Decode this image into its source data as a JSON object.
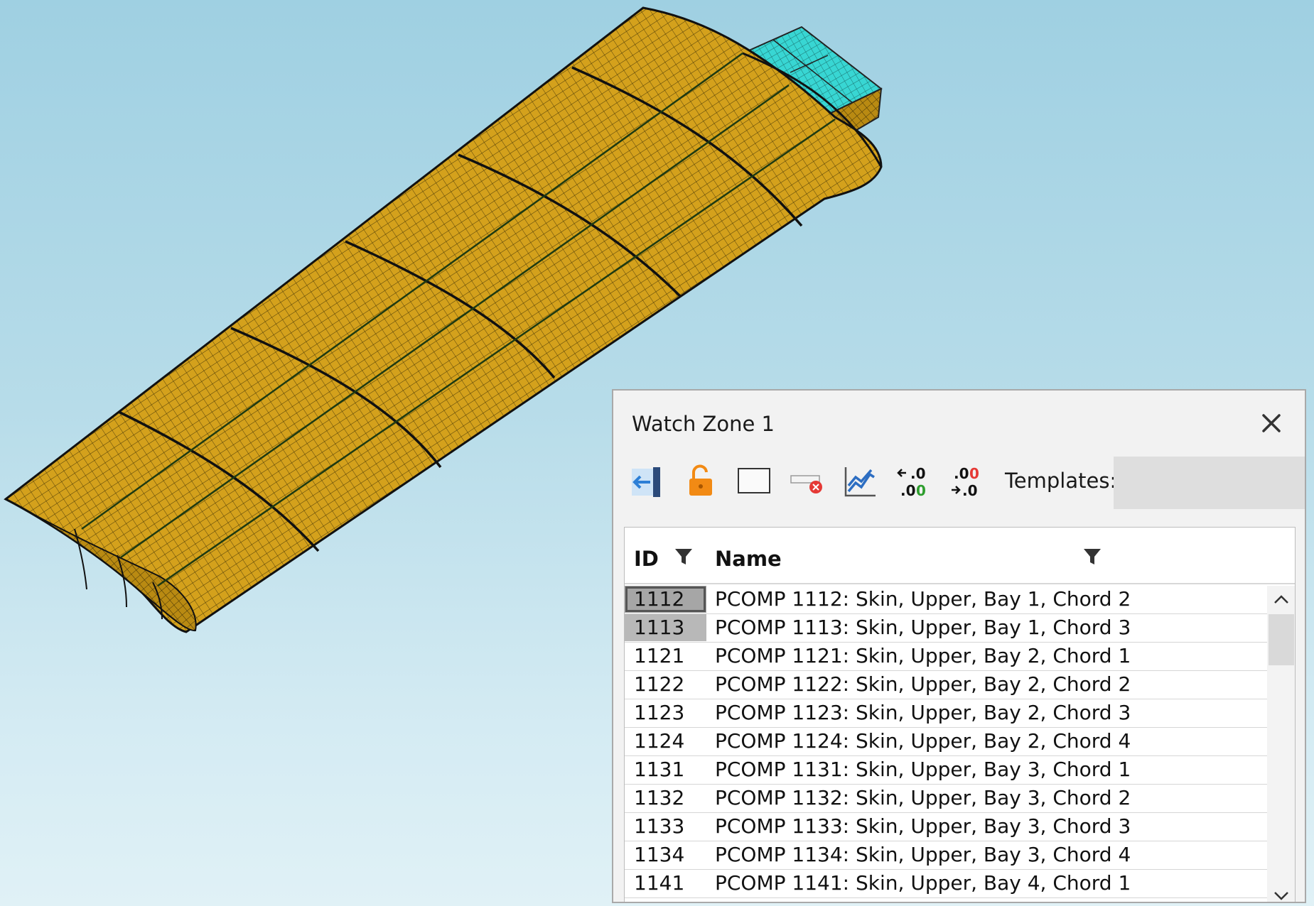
{
  "panel": {
    "title": "Watch Zone 1",
    "close_icon": "close-icon",
    "toolbar": {
      "tools": [
        {
          "name": "import-left-icon"
        },
        {
          "name": "unlock-icon"
        },
        {
          "name": "select-box-icon"
        },
        {
          "name": "clear-selection-icon"
        },
        {
          "name": "trend-chart-icon"
        },
        {
          "name": "increase-decimals-icon"
        },
        {
          "name": "decrease-decimals-icon"
        }
      ],
      "templates_label": "Templates:",
      "templates_value": ""
    },
    "table": {
      "columns": [
        "ID",
        "Name"
      ],
      "rows": [
        {
          "id": "1112",
          "name": "PCOMP 1112: Skin, Upper, Bay 1, Chord 2"
        },
        {
          "id": "1113",
          "name": "PCOMP 1113: Skin, Upper, Bay 1, Chord 3"
        },
        {
          "id": "1121",
          "name": "PCOMP 1121: Skin, Upper, Bay 2, Chord 1"
        },
        {
          "id": "1122",
          "name": "PCOMP 1122: Skin, Upper, Bay 2, Chord 2"
        },
        {
          "id": "1123",
          "name": "PCOMP 1123: Skin, Upper, Bay 2, Chord 3"
        },
        {
          "id": "1124",
          "name": "PCOMP 1124: Skin, Upper, Bay 2, Chord 4"
        },
        {
          "id": "1131",
          "name": "PCOMP 1131: Skin, Upper, Bay 3, Chord 1"
        },
        {
          "id": "1132",
          "name": "PCOMP 1132: Skin, Upper, Bay 3, Chord 2"
        },
        {
          "id": "1133",
          "name": "PCOMP 1133: Skin, Upper, Bay 3, Chord 3"
        },
        {
          "id": "1134",
          "name": "PCOMP 1134: Skin, Upper, Bay 3, Chord 4"
        },
        {
          "id": "1141",
          "name": "PCOMP 1141: Skin, Upper, Bay 4, Chord 1"
        }
      ]
    }
  },
  "colors": {
    "wing_surface": "#d4a11c",
    "wing_end": "#38d6d3",
    "mesh_line": "#4a3a08",
    "panel_background": "#f2f2f2",
    "accent_blue": "#2d7fd6",
    "accent_orange": "#f28a14",
    "accent_red": "#e53935",
    "accent_green": "#2e9e2e"
  }
}
